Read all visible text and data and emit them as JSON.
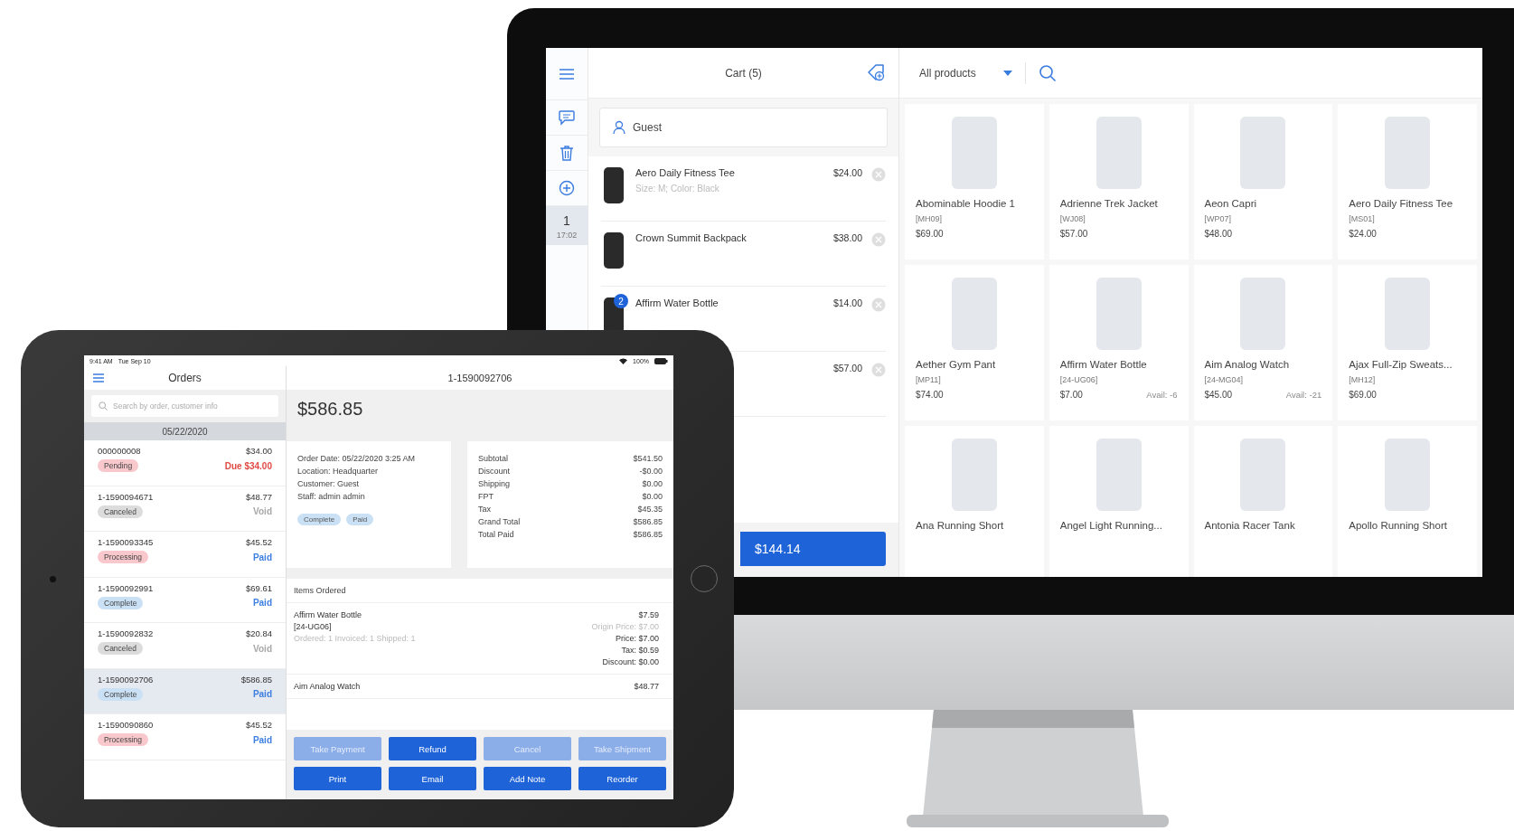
{
  "monitor": {
    "sidebar": {
      "held_carts": [
        {
          "number": "1",
          "time": "17:02",
          "selected": true
        }
      ]
    },
    "cart": {
      "title": "Cart (5)",
      "customer": "Guest",
      "items": [
        {
          "name": "Aero Daily Fitness Tee",
          "options": "Size: M; Color: Black",
          "price": "$24.00"
        },
        {
          "name": "Crown Summit Backpack",
          "price": "$38.00"
        },
        {
          "name": "Affirm Water Bottle",
          "price": "$14.00",
          "quantity": "2"
        },
        {
          "price": "$57.00"
        }
      ],
      "checkout_total": "$144.14"
    },
    "catalog": {
      "category": "All products",
      "products": [
        {
          "name": "Abominable Hoodie 1",
          "sku": "[MH09]",
          "price": "$69.00"
        },
        {
          "name": "Adrienne Trek Jacket",
          "sku": "[WJ08]",
          "price": "$57.00"
        },
        {
          "name": "Aeon Capri",
          "sku": "[WP07]",
          "price": "$48.00"
        },
        {
          "name": "Aero Daily Fitness Tee",
          "sku": "[MS01]",
          "price": "$24.00"
        },
        {
          "name": "Aether Gym Pant",
          "sku": "[MP11]",
          "price": "$74.00"
        },
        {
          "name": "Affirm Water Bottle",
          "sku": "[24-UG06]",
          "price": "$7.00",
          "availability": "Avail: -6"
        },
        {
          "name": "Aim Analog Watch",
          "sku": "[24-MG04]",
          "price": "$45.00",
          "availability": "Avail: -21"
        },
        {
          "name": "Ajax Full-Zip Sweats...",
          "sku": "[MH12]",
          "price": "$69.00"
        },
        {
          "name": "Ana Running Short"
        },
        {
          "name": "Angel Light Running..."
        },
        {
          "name": "Antonia Racer Tank"
        },
        {
          "name": "Apollo Running Short"
        }
      ]
    }
  },
  "tablet": {
    "status_bar": {
      "time": "9:41 AM",
      "date": "Tue Sep 10",
      "battery": "100%"
    },
    "orders": {
      "title": "Orders",
      "search": {
        "placeholder": "Search by order, customer info"
      },
      "date_header": "05/22/2020",
      "list": [
        {
          "id": "000000008",
          "total": "$34.00",
          "status": {
            "label": "Pending",
            "color": "#f8c8cc"
          },
          "payment": {
            "label": "Due $34.00",
            "color": "#e04b45"
          },
          "selected": false
        },
        {
          "id": "1-1590094671",
          "total": "$48.77",
          "status": {
            "label": "Canceled",
            "color": "#dcdcdc"
          },
          "payment": {
            "label": "Void",
            "color": "#a8a8a8"
          },
          "selected": false
        },
        {
          "id": "1-1590093345",
          "total": "$45.52",
          "status": {
            "label": "Processing",
            "color": "#f8c8cc"
          },
          "payment": {
            "label": "Paid",
            "color": "#3d7fe0"
          },
          "selected": false
        },
        {
          "id": "1-1590092991",
          "total": "$69.61",
          "status": {
            "label": "Complete",
            "color": "#c9e0f5"
          },
          "payment": {
            "label": "Paid",
            "color": "#3d7fe0"
          },
          "selected": false
        },
        {
          "id": "1-1590092832",
          "total": "$20.84",
          "status": {
            "label": "Canceled",
            "color": "#dcdcdc"
          },
          "payment": {
            "label": "Void",
            "color": "#a8a8a8"
          },
          "selected": false
        },
        {
          "id": "1-1590092706",
          "total": "$586.85",
          "status": {
            "label": "Complete",
            "color": "#c9e0f5"
          },
          "payment": {
            "label": "Paid",
            "color": "#3d7fe0"
          },
          "selected": true
        },
        {
          "id": "1-1590090860",
          "total": "$45.52",
          "status": {
            "label": "Processing",
            "color": "#f8c8cc"
          },
          "payment": {
            "label": "Paid",
            "color": "#3d7fe0"
          },
          "selected": false
        }
      ]
    },
    "detail": {
      "title": "1-1590092706",
      "amount": "$586.85",
      "info": [
        "Order Date: 05/22/2020 3:25 AM",
        "Location: Headquarter",
        "Customer: Guest",
        "Staff: admin admin"
      ],
      "tags": [
        {
          "label": "Complete",
          "color": "#c9e0f5"
        },
        {
          "label": "Paid",
          "color": "#c9e0f5"
        }
      ],
      "totals": [
        {
          "label": "Subtotal",
          "value": "$541.50"
        },
        {
          "label": "Discount",
          "value": "-$0.00"
        },
        {
          "label": "Shipping",
          "value": "$0.00"
        },
        {
          "label": "FPT",
          "value": "$0.00"
        },
        {
          "label": "Tax",
          "value": "$45.35"
        },
        {
          "label": "Grand Total",
          "value": "$586.85"
        },
        {
          "label": "Total Paid",
          "value": "$586.85"
        }
      ],
      "items_header": "Items Ordered",
      "items": [
        {
          "name": "Affirm Water Bottle",
          "sku": "[24-UG06]",
          "quantities": "Ordered: 1  Invoiced: 1  Shipped: 1",
          "total": "$7.59",
          "lines": [
            "Origin Price: $7.00",
            "Price: $7.00",
            "Tax: $0.59",
            "Discount: $0.00"
          ]
        },
        {
          "name": "Aim Analog Watch",
          "total": "$48.77"
        }
      ],
      "buttons": [
        {
          "label": "Take Payment",
          "disabled": true
        },
        {
          "label": "Refund",
          "disabled": false
        },
        {
          "label": "Cancel",
          "disabled": true
        },
        {
          "label": "Take Shipment",
          "disabled": true
        },
        {
          "label": "Print",
          "disabled": false
        },
        {
          "label": "Email",
          "disabled": false
        },
        {
          "label": "Add Note",
          "disabled": false
        },
        {
          "label": "Reorder",
          "disabled": false
        }
      ]
    }
  }
}
